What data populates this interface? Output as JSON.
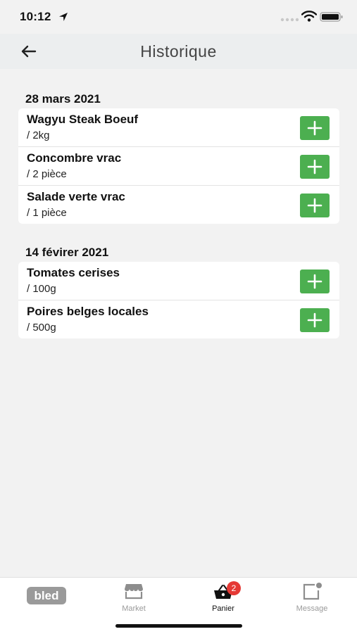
{
  "status": {
    "time": "10:12"
  },
  "header": {
    "title": "Historique"
  },
  "sections": [
    {
      "date": "28 mars 2021",
      "items": [
        {
          "name": "Wagyu Steak Boeuf",
          "qty": "/ 2kg"
        },
        {
          "name": "Concombre vrac",
          "qty": "/ 2 pièce"
        },
        {
          "name": "Salade verte vrac",
          "qty": "/ 1 pièce"
        }
      ]
    },
    {
      "date": "14 févirer 2021",
      "items": [
        {
          "name": "Tomates cerises",
          "qty": "/ 100g"
        },
        {
          "name": "Poires belges locales",
          "qty": "/ 500g"
        }
      ]
    }
  ],
  "tabbar": {
    "logo": "bled",
    "market": "Market",
    "panier": "Panier",
    "message": "Message",
    "cart_count": "2"
  },
  "colors": {
    "accent_green": "#4caf50",
    "badge_red": "#e53935"
  },
  "icons": [
    "arrow-left-icon",
    "plus-icon",
    "store-icon",
    "basket-icon",
    "message-icon"
  ]
}
